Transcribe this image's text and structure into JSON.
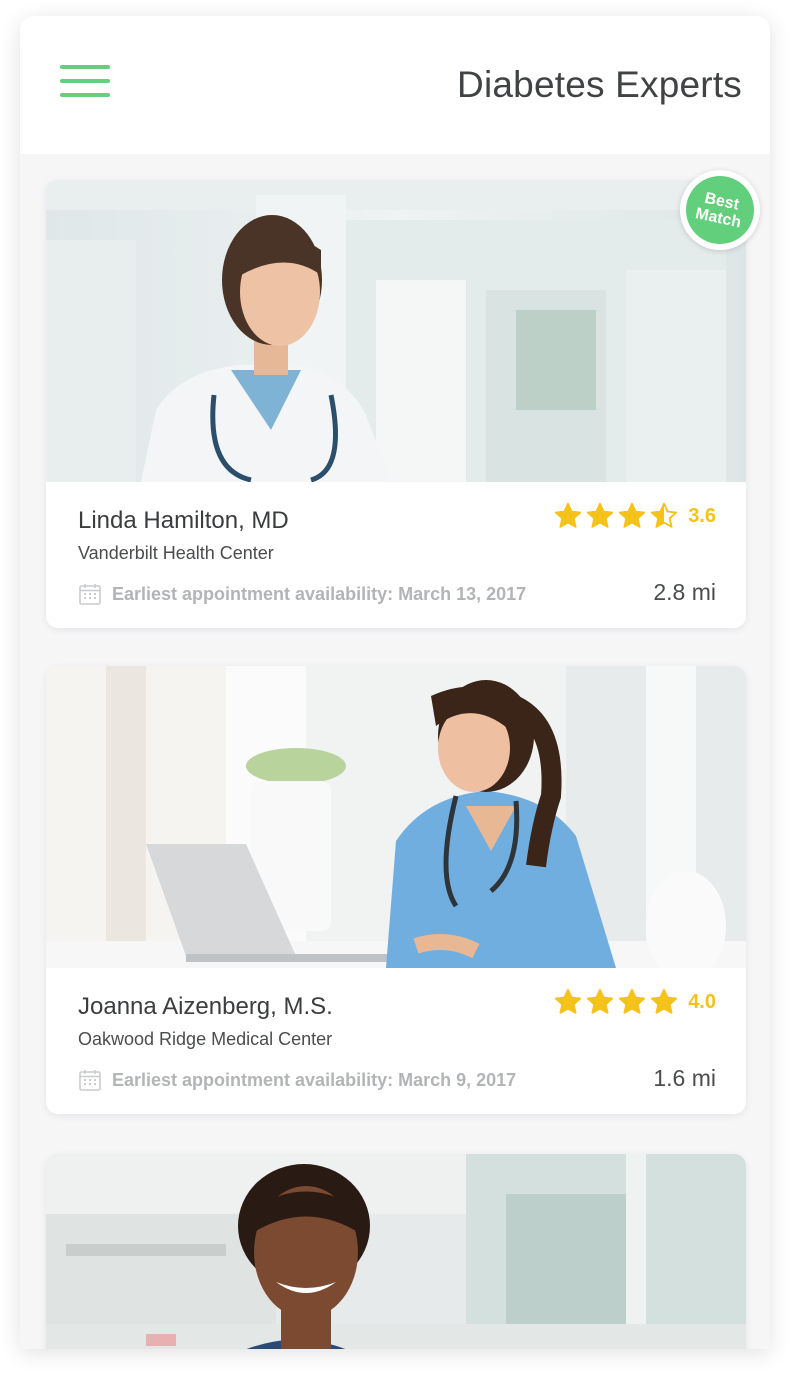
{
  "header": {
    "title": "Diabetes Experts",
    "menu_icon": "hamburger-menu-icon"
  },
  "accent_color": "#66cf7f",
  "star_color": "#f5c21b",
  "doctors": [
    {
      "name": "Linda Hamilton, MD",
      "center": "Vanderbilt Health Center",
      "rating": "3.6",
      "rating_value": 3.6,
      "appointment": "Earliest appointment availability: March 13, 2017",
      "distance": "2.8 mi",
      "badge": {
        "line1": "Best",
        "line2": "Match"
      }
    },
    {
      "name": "Joanna Aizenberg, M.S.",
      "center": "Oakwood Ridge Medical Center",
      "rating": "4.0",
      "rating_value": 4.0,
      "appointment": "Earliest appointment availability: March 9, 2017",
      "distance": "1.6 mi"
    },
    {
      "name": "",
      "center": ""
    }
  ]
}
